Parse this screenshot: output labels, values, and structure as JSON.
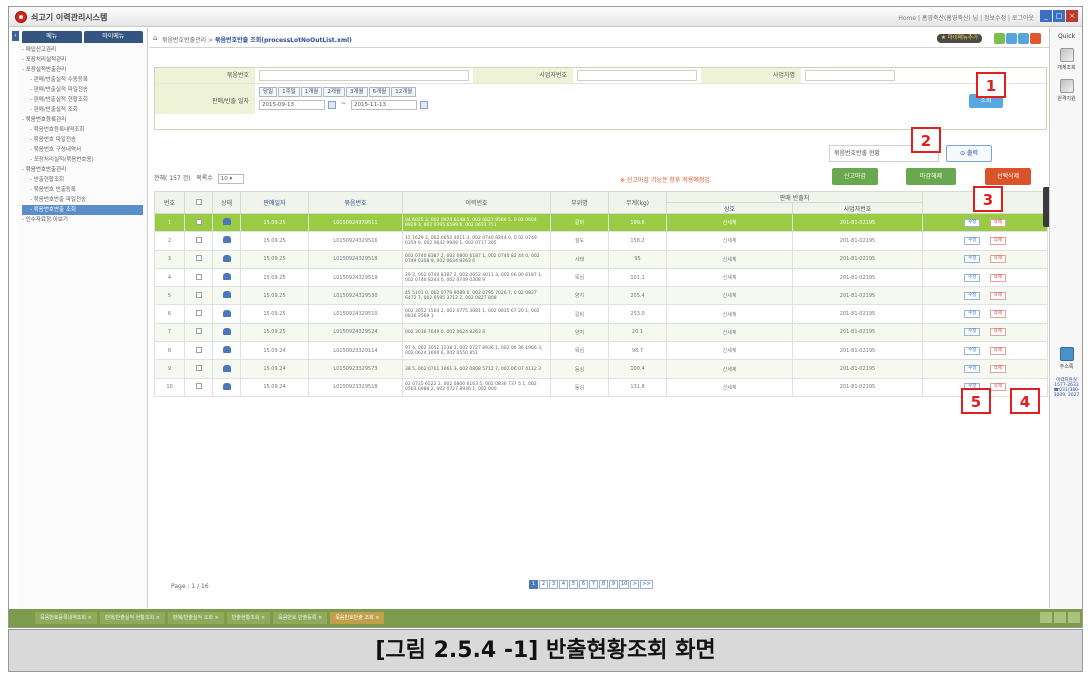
{
  "app": {
    "title": "쇠고기 이력관리시스템",
    "top_right_links": "Home | 홈영축산(홈영축산) 님 | 정보수정 | 로그아웃"
  },
  "sidebar": {
    "tabs": [
      "메뉴",
      "마이메뉴"
    ],
    "items": [
      {
        "label": "- 매입신고관리",
        "level": 1
      },
      {
        "label": "- 포장처리실적관리",
        "level": 1
      },
      {
        "label": "- 포장실적반출관리",
        "level": 1
      },
      {
        "label": "- 판매/반출실적 수동등록",
        "level": 2
      },
      {
        "label": "- 판매/반출실적 파일전송",
        "level": 2
      },
      {
        "label": "- 판매/반출실적 현황조회",
        "level": 2
      },
      {
        "label": "- 판매/반출실적 조회",
        "level": 2
      },
      {
        "label": "- 묶음번호등록관리",
        "level": 1
      },
      {
        "label": "- 묶음번호등록내역조회",
        "level": 2
      },
      {
        "label": "- 묶음번호 파일전송",
        "level": 2
      },
      {
        "label": "- 묶음번호 구성내역서",
        "level": 2
      },
      {
        "label": "- 포장처리실적(묶음번호용)",
        "level": 2
      },
      {
        "label": "- 묶음번호반출관리",
        "level": 1
      },
      {
        "label": "- 반출현황조회",
        "level": 2
      },
      {
        "label": "- 묶음번호 반출등록",
        "level": 2
      },
      {
        "label": "- 묶음번호반출 파일전송",
        "level": 2
      },
      {
        "label": "- 묶음번호반출 조회",
        "level": 2,
        "selected": true
      },
      {
        "label": "- 인수자료정 이보기",
        "level": 1
      }
    ]
  },
  "header": {
    "breadcrumb_prefix": "묶음번호반출관리 > ",
    "breadcrumb_current": "묶음번호반출 조회(processLotNoOutList.xml)",
    "favorite_label": "★ 마이메뉴추가"
  },
  "search": {
    "bundle_no_label": "묶음번호",
    "biz_no_label": "사업자번호",
    "biz_name_label": "사업자명",
    "date_label": "판매/반출 일자",
    "periods": [
      "당일",
      "1주일",
      "1개월",
      "2개월",
      "3개월",
      "6개월",
      "12개월"
    ],
    "date_from": "2015-09-13",
    "date_to": "2015-11-13",
    "search_button": "조회"
  },
  "output": {
    "select_value": "묶음번호반출 현황",
    "button": "출력"
  },
  "list": {
    "count_label": "전체( 157 건)",
    "per_page_label": "목록수",
    "per_page_value": "10",
    "notice": "※ 신고마감 기능은 향후 적용예정임.",
    "buttons": [
      "신고마감",
      "마감해제",
      "선택삭제"
    ]
  },
  "table": {
    "headers": [
      "번호",
      "",
      "상태",
      "판매일자",
      "묶음번호",
      "이력번호",
      "부위명",
      "무게(kg)",
      "판매 반출처",
      "관리"
    ],
    "sub_headers": [
      "상호",
      "사업자번호"
    ],
    "edit_label": "수정",
    "delete_label": "삭제",
    "rows": [
      {
        "no": "1",
        "date": "15.09.25",
        "lot": "L0150924329511",
        "trace": "04 6025 3, 002 0974 6148 5, 002 0827 8566 5, 0 02 0604 8929 3, 002 0795 6599 6, 002 0651 751",
        "part": "갈비",
        "weight": "199.6",
        "name": "신세계",
        "biz": "201-81-02195"
      },
      {
        "no": "2",
        "date": "15.09.25",
        "lot": "L0150924329516",
        "trace": "15 1629 2, 002 0652 4011 3, 002 0740 8244 0, 0 02 0749 0359 9, 002 0642 9949 1, 002 0717 305",
        "part": "설도",
        "weight": "158.2",
        "name": "신세계",
        "biz": "201-81-02195"
      },
      {
        "no": "3",
        "date": "15.09.25",
        "lot": "L0150924329518",
        "trace": "002 0740 8387 2, 002 0800 6187 1, 002 0740 82 44 0, 002 0749 0308 9, 002 0634 8263 6",
        "part": "사태",
        "weight": "95",
        "name": "신세계",
        "biz": "201-81-02195"
      },
      {
        "no": "4",
        "date": "15.09.25",
        "lot": "L0150924329519",
        "trace": "29 2, 002 0740 8387 2, 002 0652 4011 3, 002 06 00 6187 1, 002 0740 8244 0, 002 0749 0308 9",
        "part": "목심",
        "weight": "101.1",
        "name": "신세계",
        "biz": "201-81-02195"
      },
      {
        "no": "5",
        "date": "15.09.25",
        "lot": "L0150924329530",
        "trace": "45 5101 0, 002 0779 9089 6, 002 0795 7026 7, 0 02 0827 6472 7, 002 0595 3712 2, 002 0827 808",
        "part": "양지",
        "weight": "205.4",
        "name": "신세계",
        "biz": "201-81-02195"
      },
      {
        "no": "6",
        "date": "15.09.25",
        "lot": "L0150924329510",
        "trace": "002 3052 1564 2, 002 0775 3081 1, 002 0835 67 20 1, 002 0836 3569 1",
        "part": "갈비",
        "weight": "253.0",
        "name": "신세계",
        "biz": "201-81-02195"
      },
      {
        "no": "7",
        "date": "15.09.25",
        "lot": "L0150924329524",
        "trace": "002 3036 7649 0, 002 0624 8263 6",
        "part": "양지",
        "weight": "20.1",
        "name": "신세계",
        "biz": "201-81-02195"
      },
      {
        "no": "8",
        "date": "15.09.24",
        "lot": "L0150923329114",
        "trace": "97 4, 002 3052 1138 3, 002 0727 8936 1, 002 06 36 1966 3, 002 0624 1600 6, 002 0550 851",
        "part": "목심",
        "weight": "98.7",
        "name": "신세계",
        "biz": "201-81-02195"
      },
      {
        "no": "9",
        "date": "15.09.24",
        "lot": "L0150923329573",
        "trace": "38 5, 002 0761 1061 3, 002 0808 5712 7, 002 06 07 4112 3",
        "part": "등심",
        "weight": "100.4",
        "name": "신세계",
        "biz": "201-81-02195"
      },
      {
        "no": "10",
        "date": "15.09.24",
        "lot": "L0150923329518",
        "trace": "02 0735 6522 2, 002 0800 6163 5, 002 0836 737 5 1, 002 0563 6988 2, 002 0727 8936 1, 002 000",
        "part": "등심",
        "weight": "131.8",
        "name": "신세계",
        "biz": "201-81-02195"
      }
    ]
  },
  "pagination": {
    "info": "Page : 1 / 16",
    "pages": [
      "1",
      "2",
      "3",
      "4",
      "5",
      "6",
      "7",
      "8",
      "9",
      "10"
    ],
    "next": ">",
    "last": ">>"
  },
  "callouts": [
    "1",
    "2",
    "3",
    "4",
    "5"
  ],
  "quick": {
    "title": "Quick",
    "items": [
      "개체조회",
      "원격지원"
    ],
    "address_label": "주소록",
    "support_text": "이력지원실 1577-2633 ☎031)380-3009, 3027"
  },
  "bottom_tabs": [
    "묶음번호등록내역조회",
    "판매/반출실적 현황조회",
    "판매/반출실적 조회",
    "반출현황조회",
    "묶음번호 반출등록",
    "묶음번호반출 조회"
  ],
  "caption": "[그림 2.5.4 -1] 반출현황조회 화면"
}
